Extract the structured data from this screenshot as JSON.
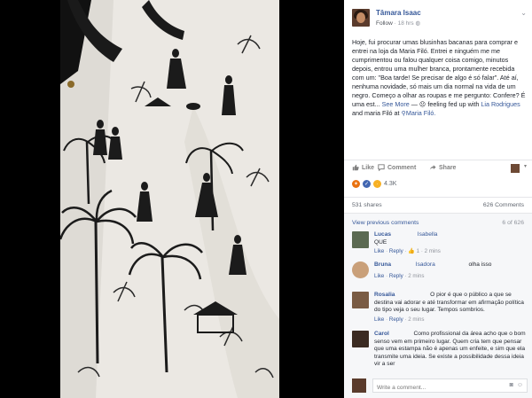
{
  "post": {
    "author": "Tâmara Isaac",
    "follow_label": "Follow",
    "time": "18 hrs",
    "text_main": "Hoje, fui procurar umas blusinhas bacanas para comprar e entrei na loja da Maria Filó. Entrei e ninguém me me cumprimentou ou falou qualquer coisa comigo, minutos depois, entrou uma mulher branca, prontamente recebida com um: \"Boa tarde! Se precisar de algo é só falar\". Até aí, nenhuma novidade, só mais um dia normal na vida de um negro. Começo a olhar as roupas e me pergunto: Confere? É uma est... ",
    "see_more": "See More",
    "dash": " — ",
    "feeling": " feeling fed up with ",
    "tag1": "Lia Rodrigues",
    "and_text": " and ",
    "tag2": "maria Filó",
    "at_text": " at ",
    "place": "Maria Filó."
  },
  "actions": {
    "like": "Like",
    "comment": "Comment",
    "share": "Share"
  },
  "reactions": {
    "count": "4.3K"
  },
  "stats": {
    "shares": "531 shares",
    "comments": "626 Comments"
  },
  "comments_area": {
    "view_previous": "View previous comments",
    "count_label": "6 of 626",
    "comments": [
      {
        "name": "Lucas",
        "tag": "Isabella",
        "text": "QUE",
        "meta_like": "Like",
        "meta_reply": "Reply",
        "likes": "1",
        "time": "2 mins",
        "avatar_color": "#5b6a52"
      },
      {
        "name": "Bruna",
        "tag": "Isadora",
        "text": "olha isso",
        "meta_like": "Like",
        "meta_reply": "Reply",
        "likes": "",
        "time": "2 mins",
        "avatar_color": "#c9a07a"
      },
      {
        "name": "Rosalia",
        "tag": "",
        "text": "O pior é que o público a que se destina vai adorar e até transformar em afirmação política do tipo veja o seu lugar. Tempos sombrios.",
        "meta_like": "Like",
        "meta_reply": "Reply",
        "likes": "",
        "time": "2 mins",
        "avatar_color": "#7a5c44"
      },
      {
        "name": "Carol",
        "tag": "",
        "text": "Como profissional da área acho que o bom senso vem em primeiro lugar. Quem cria tem que pensar que uma estampa não é apenas um enfeite, e sim que ela transmite uma ideia. Se existe a possibilidade dessa ideia vir a ser",
        "meta_like": "",
        "meta_reply": "",
        "likes": "",
        "time": "",
        "avatar_color": "#3b2b22"
      }
    ],
    "write_placeholder": "Write a comment..."
  },
  "icons": {
    "more": "chevron-down-icon",
    "like": "thumbs-up-icon",
    "comment": "speech-bubble-icon",
    "share": "share-arrow-icon",
    "camera": "camera-icon",
    "emoji": "smile-icon"
  },
  "colors": {
    "link": "#365899",
    "panel_bg": "#ffffff",
    "comments_bg": "#f6f7f9",
    "backdrop": "#000000"
  }
}
